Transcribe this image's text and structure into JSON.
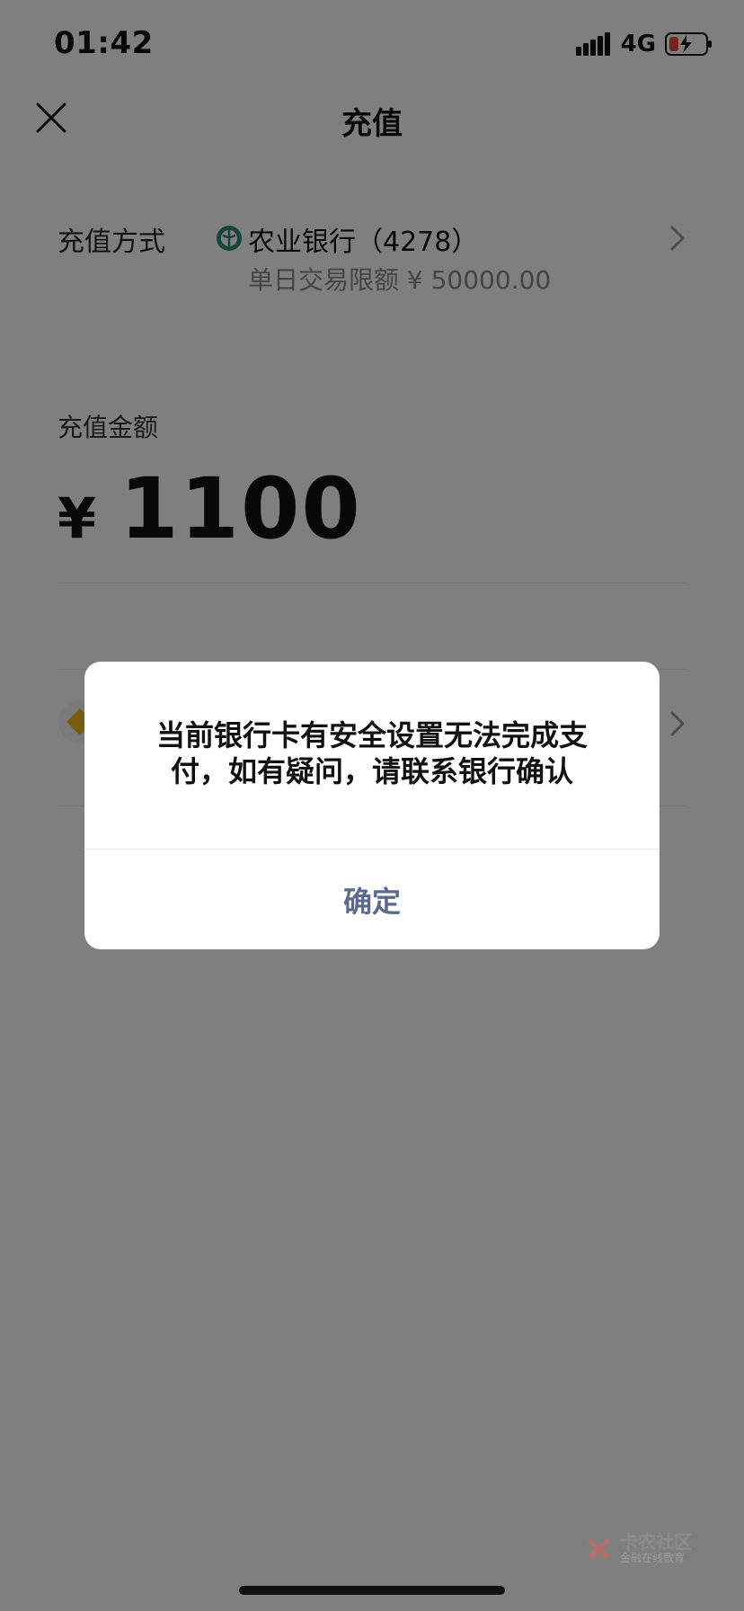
{
  "status_bar": {
    "time": "01:42",
    "network": "4G"
  },
  "header": {
    "title": "充值",
    "close_icon": "close-icon"
  },
  "payment_method": {
    "label": "充值方式",
    "bank_name": "农业银行（4278）",
    "daily_limit": "单日交易限额 ¥ 50000.00",
    "bank_logo_icon": "bank-logo-icon",
    "chevron_icon": "chevron-right-icon"
  },
  "amount": {
    "label": "充值金额",
    "currency": "¥",
    "value": "1100"
  },
  "dialog": {
    "message_line1": "当前银行卡有安全设置无法完成支",
    "message_line2": "付，如有疑问，请联系银行确认",
    "confirm_label": "确定"
  },
  "watermark": {
    "title": "卡农社区",
    "subtitle": "金融在线教育"
  },
  "colors": {
    "dialog_button": "#5a6b8f",
    "overlay": "rgba(0,0,0,0.5)",
    "bank_logo": "#2f8a73"
  }
}
